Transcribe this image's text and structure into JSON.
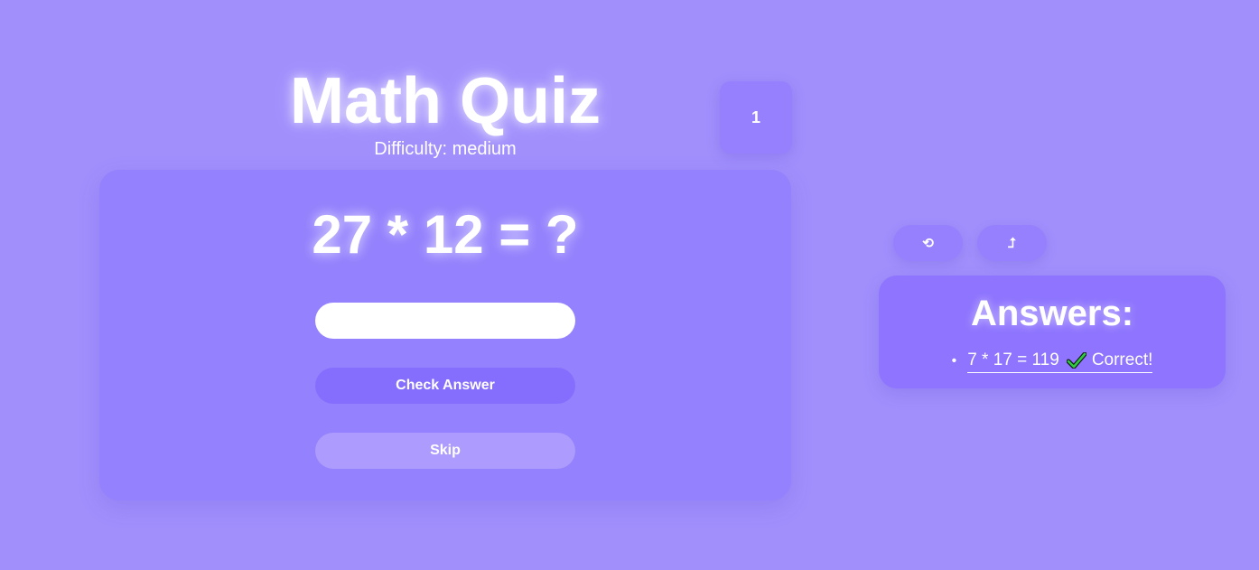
{
  "header": {
    "title": "Math Quiz",
    "difficulty": "Difficulty: medium",
    "score": "1"
  },
  "quiz": {
    "question": "27 * 12 = ?",
    "answer_value": "",
    "answer_placeholder": "",
    "check_label": "Check Answer",
    "skip_label": "Skip"
  },
  "controls": {
    "restart_icon": "restart-icon",
    "restart_glyph": "⟲",
    "share_icon": "share-icon",
    "share_glyph": "⮥"
  },
  "answers": {
    "title": "Answers:",
    "bullet": "•",
    "items": [
      {
        "expression": "7 * 17 = 119",
        "status_icon": "check-icon",
        "result": "Correct!"
      }
    ]
  },
  "colors": {
    "background": "#a18ffc",
    "card": "#9381fd",
    "primary_button": "#856efe",
    "secondary_button": "#ad9bfd",
    "answers_card": "#8e74fe",
    "correct_check": "#2ecc40"
  }
}
